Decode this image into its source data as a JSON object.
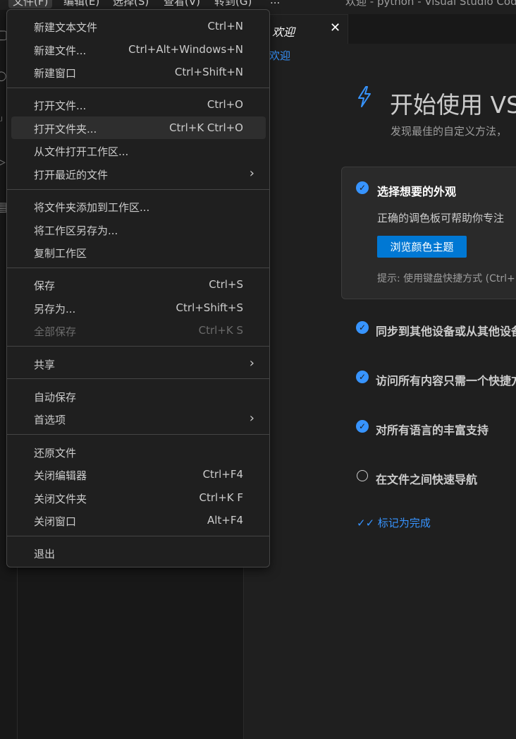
{
  "window": {
    "title": "欢迎 - python - Visual Studio Code"
  },
  "menubar": {
    "items": [
      "文件(F)",
      "编辑(E)",
      "选择(S)",
      "查看(V)",
      "转到(G)",
      "..."
    ]
  },
  "tab": {
    "label": "欢迎"
  },
  "breadcrumb": "欢迎",
  "welcome": {
    "title": "开始使用 VS",
    "subtitle": "发现最佳的自定义方法，",
    "card": {
      "title": "选择想要的外观",
      "description": "正确的调色板可帮助你专注",
      "button": "浏览颜色主题",
      "hint": "提示: 使用键盘快捷方式 (Ctrl+"
    },
    "steps": [
      {
        "label": "同步到其他设备或从其他设备",
        "done": true
      },
      {
        "label": "访问所有内容只需一个快捷方",
        "done": true
      },
      {
        "label": "对所有语言的丰富支持",
        "done": true
      },
      {
        "label": "在文件之间快速导航",
        "done": false
      }
    ],
    "mark_done": "标记为完成"
  },
  "file_menu": {
    "groups": [
      [
        {
          "label": "新建文本文件",
          "shortcut": "Ctrl+N"
        },
        {
          "label": "新建文件...",
          "shortcut": "Ctrl+Alt+Windows+N"
        },
        {
          "label": "新建窗口",
          "shortcut": "Ctrl+Shift+N"
        }
      ],
      [
        {
          "label": "打开文件...",
          "shortcut": "Ctrl+O"
        },
        {
          "label": "打开文件夹...",
          "shortcut": "Ctrl+K Ctrl+O"
        },
        {
          "label": "从文件打开工作区...",
          "shortcut": ""
        },
        {
          "label": "打开最近的文件",
          "shortcut": ""
        }
      ],
      [
        {
          "label": "将文件夹添加到工作区...",
          "shortcut": ""
        },
        {
          "label": "将工作区另存为...",
          "shortcut": ""
        },
        {
          "label": "复制工作区",
          "shortcut": ""
        }
      ],
      [
        {
          "label": "保存",
          "shortcut": "Ctrl+S"
        },
        {
          "label": "另存为...",
          "shortcut": "Ctrl+Shift+S"
        },
        {
          "label": "全部保存",
          "shortcut": "Ctrl+K S"
        }
      ],
      [
        {
          "label": "共享",
          "shortcut": ""
        }
      ],
      [
        {
          "label": "自动保存",
          "shortcut": ""
        },
        {
          "label": "首选项",
          "shortcut": ""
        }
      ],
      [
        {
          "label": "还原文件",
          "shortcut": ""
        },
        {
          "label": "关闭编辑器",
          "shortcut": "Ctrl+F4"
        },
        {
          "label": "关闭文件夹",
          "shortcut": "Ctrl+K F"
        },
        {
          "label": "关闭窗口",
          "shortcut": "Alt+F4"
        }
      ],
      [
        {
          "label": "退出",
          "shortcut": ""
        }
      ]
    ],
    "hovered_item": "打开文件夹...",
    "disabled_item": "全部保存"
  },
  "colors": {
    "accent": "#3794ff",
    "button": "#0078d4",
    "menu_bg": "#1f1f1f"
  }
}
